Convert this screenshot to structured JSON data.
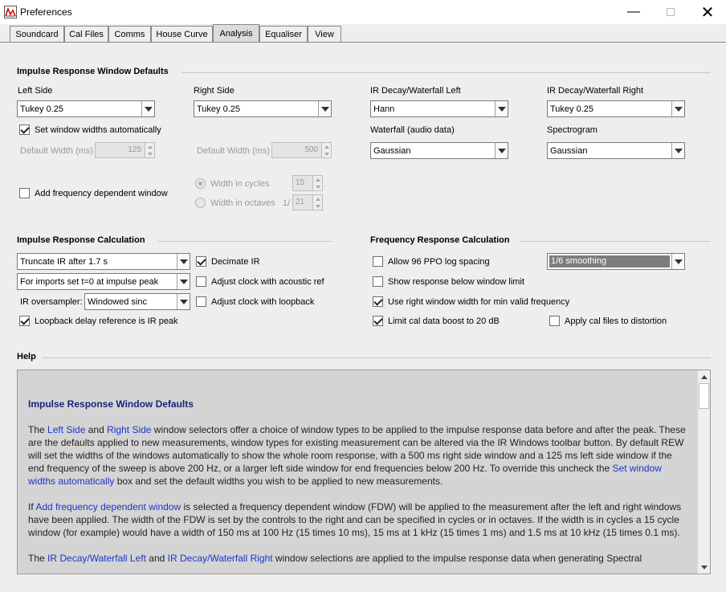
{
  "window": {
    "title": "Preferences"
  },
  "tabs": [
    "Soundcard",
    "Cal Files",
    "Comms",
    "House Curve",
    "Analysis",
    "Equaliser",
    "View"
  ],
  "active_tab": "Analysis",
  "irwd": {
    "heading": "Impulse Response Window Defaults",
    "left_side_label": "Left Side",
    "left_side_value": "Tukey 0.25",
    "right_side_label": "Right Side",
    "right_side_value": "Tukey 0.25",
    "set_auto_label": "Set window widths automatically",
    "default_width_left_label": "Default Width (ms)",
    "default_width_left_value": "125",
    "default_width_right_label": "Default Width (ms)",
    "default_width_right_value": "500",
    "add_fdw_label": "Add frequency dependent window",
    "width_cycles_label": "Width in cycles",
    "width_cycles_value": "15",
    "width_octaves_label": "Width in octaves",
    "octaves_prefix": "1/",
    "width_octaves_value": "21",
    "ir_decay_left_label": "IR Decay/Waterfall Left",
    "ir_decay_left_value": "Hann",
    "ir_decay_right_label": "IR Decay/Waterfall Right",
    "ir_decay_right_value": "Tukey 0.25",
    "waterfall_label": "Waterfall (audio data)",
    "waterfall_value": "Gaussian",
    "spectrogram_label": "Spectrogram",
    "spectrogram_value": "Gaussian"
  },
  "irc": {
    "heading": "Impulse Response Calculation",
    "truncate_value": "Truncate IR after 1.7 s",
    "imports_value": "For imports set t=0 at impulse peak",
    "oversampler_label": "IR oversampler:",
    "oversampler_value": "Windowed sinc",
    "loopback_label": "Loopback delay reference is IR peak",
    "decimate_label": "Decimate IR",
    "adjust_acoustic_label": "Adjust clock with acoustic ref",
    "adjust_loopback_label": "Adjust clock with loopback"
  },
  "frc": {
    "heading": "Frequency Response Calculation",
    "allow96_label": "Allow 96 PPO log spacing",
    "smoothing_value": "1/6 smoothing",
    "show_below_label": "Show response below window limit",
    "use_right_label": "Use right window width for min valid frequency",
    "limit_cal_label": "Limit cal data boost to 20 dB",
    "apply_cal_label": "Apply cal files to distortion"
  },
  "help": {
    "heading": "Help",
    "title": "Impulse Response Window Defaults",
    "p1": [
      {
        "t": "The "
      },
      {
        "t": "Left Side",
        "link": true
      },
      {
        "t": " and "
      },
      {
        "t": "Right Side",
        "link": true
      },
      {
        "t": " window selectors offer a choice of window types to be applied to the impulse response data before and after the peak. These are the defaults applied to new measurements, window types for existing measurement can be altered via the IR Windows toolbar button. By default REW will set the widths of the windows automatically to show the whole room response, with a 500 ms right side window and a 125 ms left side window if the end frequency of the sweep is above 200 Hz, or a larger left side window for end frequencies below 200 Hz. To override this uncheck the "
      },
      {
        "t": "Set window widths automatically",
        "link": true
      },
      {
        "t": " box and set the default widths you wish to be applied to new measurements."
      }
    ],
    "p2": [
      {
        "t": "If "
      },
      {
        "t": "Add frequency dependent window",
        "link": true
      },
      {
        "t": " is selected a frequency dependent window (FDW) will be applied to the measurement after the left and right windows have been applied. The width of the FDW is set by the controls to the right and can be specified in cycles or in octaves. If the width is in cycles a 15 cycle window (for example) would have a width of 150 ms at 100 Hz (15 times 10 ms), 15 ms at 1 kHz (15 times 1 ms) and 1.5 ms at 10 kHz (15 times 0.1 ms)."
      }
    ],
    "p3": [
      {
        "t": "The "
      },
      {
        "t": "IR Decay/Waterfall Left",
        "link": true
      },
      {
        "t": " and "
      },
      {
        "t": "IR Decay/Waterfall Right",
        "link": true
      },
      {
        "t": " window selections are applied to the impulse response data when generating Spectral"
      }
    ]
  }
}
